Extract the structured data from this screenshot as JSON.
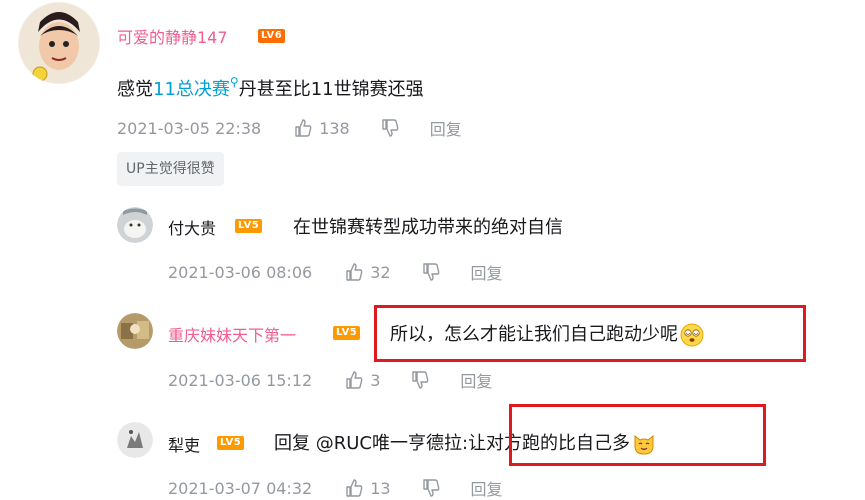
{
  "main_comment": {
    "username": "可爱的静静147",
    "level": "LV6",
    "text_before": "感觉",
    "link_text": "11总决赛",
    "text_after": "丹甚至比11世锦赛还强",
    "time": "2021-03-05 22:38",
    "likes": "138",
    "reply_label": "回复",
    "up_badge": "UP主觉得很赞",
    "username_color": "#f25d8e"
  },
  "replies": [
    {
      "username": "付大贵",
      "level": "LV5",
      "text": "在世锦赛转型成功带来的绝对自信",
      "time": "2021-03-06 08:06",
      "likes": "32",
      "reply_label": "回复"
    },
    {
      "username": "重庆妹妹天下第一",
      "level": "LV5",
      "text": "所以，怎么才能让我们自己跑动少呢",
      "emoji": "dizzy-face-emoji",
      "time": "2021-03-06 15:12",
      "likes": "3",
      "reply_label": "回复",
      "username_color": "#f25d8e"
    },
    {
      "username": "犁吏",
      "level": "LV5",
      "reply_prefix": "回复 ",
      "reply_to": "@RUC唯一亨德拉",
      "text": "让对方跑的比自己多",
      "emoji": "cat-face-emoji",
      "time": "2021-03-07 04:32",
      "likes": "13",
      "reply_label": "回复"
    }
  ],
  "colors": {
    "link": "#00a1d6",
    "meta": "#9499a0",
    "highlight": "#e0191f",
    "level_lv6": "#ff6c00",
    "level_lv5": "#ff9900"
  }
}
